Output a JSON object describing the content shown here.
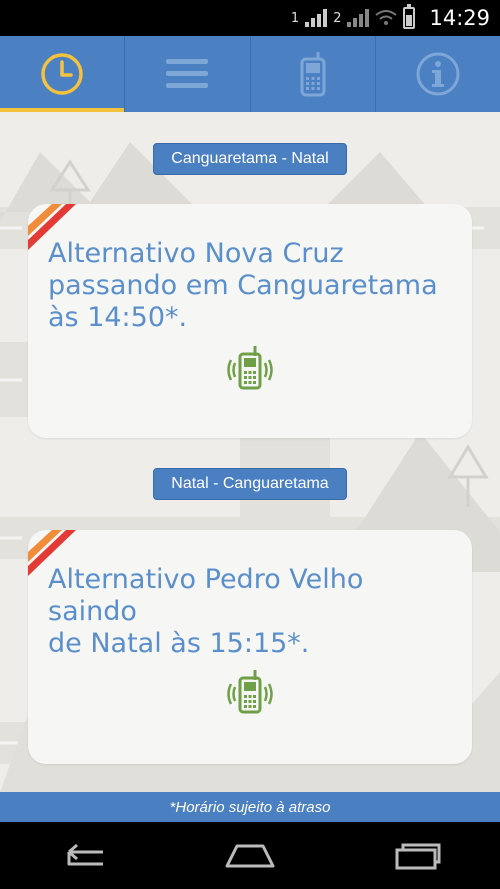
{
  "status_bar": {
    "sim1": "1",
    "sim2": "2",
    "time": "14:29"
  },
  "nav_tabs": [
    {
      "icon": "clock-icon",
      "active": true
    },
    {
      "icon": "menu-icon",
      "active": false
    },
    {
      "icon": "phone-icon",
      "active": false
    },
    {
      "icon": "info-icon",
      "active": false
    }
  ],
  "routes": [
    {
      "label": "Canguaretama - Natal",
      "card_lines": [
        "Alternativo Nova Cruz",
        "passando em Canguaretama",
        "às 14:50*."
      ]
    },
    {
      "label": "Natal - Canguaretama",
      "card_lines": [
        "Alternativo Pedro Velho saindo",
        "de Natal às 15:15*."
      ]
    }
  ],
  "footer_note": "*Horário sujeito à atraso",
  "colors": {
    "primary": "#4a7fc1",
    "accent": "#f4c23d",
    "card_text": "#5b8fcb",
    "phone_green": "#6fa047"
  }
}
